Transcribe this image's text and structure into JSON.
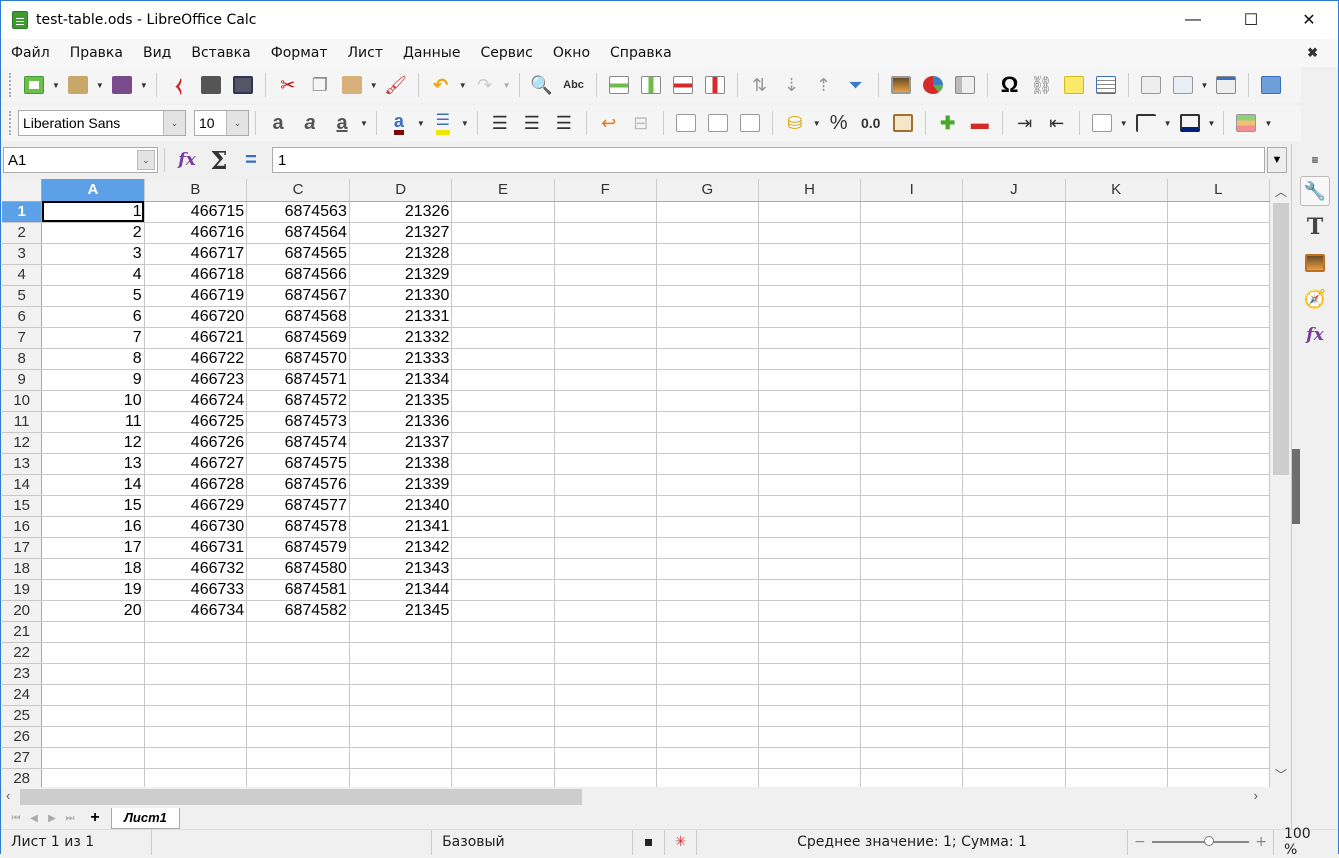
{
  "window": {
    "title": "test-table.ods - LibreOffice Calc",
    "minimize": "—",
    "maximize": "☐",
    "close": "✕"
  },
  "menu": [
    "Файл",
    "Правка",
    "Вид",
    "Вставка",
    "Формат",
    "Лист",
    "Данные",
    "Сервис",
    "Окно",
    "Справка"
  ],
  "menu_close": "✖",
  "toolbar_standard": [
    "new",
    "open",
    "save",
    "export-pdf",
    "print",
    "print-preview",
    "cut",
    "copy",
    "paste",
    "clone-formatting",
    "undo",
    "redo",
    "find-replace",
    "spelling",
    "insert-row",
    "insert-column",
    "delete-row",
    "delete-column",
    "sort",
    "sort-ascending",
    "sort-descending",
    "autofilter",
    "image",
    "chart",
    "pivot-table",
    "special-character",
    "hyperlink",
    "comment",
    "header-footer",
    "define-print-area",
    "freeze-rows-columns",
    "split-window",
    "show-draw-functions"
  ],
  "formatting": {
    "font_name": "Liberation Sans",
    "font_size": "10",
    "percent": "%",
    "number": "0.0",
    "add_decimal": ".0\n.00",
    "del_decimal": ".00"
  },
  "formula_bar": {
    "name_box": "A1",
    "content": "1",
    "fx": "fx",
    "sigma": "Σ",
    "equals": "="
  },
  "columns": [
    "A",
    "B",
    "C",
    "D",
    "E",
    "F",
    "G",
    "H",
    "I",
    "J",
    "K",
    "L"
  ],
  "rows": [
    [
      "1",
      "466715",
      "6874563",
      "21326"
    ],
    [
      "2",
      "466716",
      "6874564",
      "21327"
    ],
    [
      "3",
      "466717",
      "6874565",
      "21328"
    ],
    [
      "4",
      "466718",
      "6874566",
      "21329"
    ],
    [
      "5",
      "466719",
      "6874567",
      "21330"
    ],
    [
      "6",
      "466720",
      "6874568",
      "21331"
    ],
    [
      "7",
      "466721",
      "6874569",
      "21332"
    ],
    [
      "8",
      "466722",
      "6874570",
      "21333"
    ],
    [
      "9",
      "466723",
      "6874571",
      "21334"
    ],
    [
      "10",
      "466724",
      "6874572",
      "21335"
    ],
    [
      "11",
      "466725",
      "6874573",
      "21336"
    ],
    [
      "12",
      "466726",
      "6874574",
      "21337"
    ],
    [
      "13",
      "466727",
      "6874575",
      "21338"
    ],
    [
      "14",
      "466728",
      "6874576",
      "21339"
    ],
    [
      "15",
      "466729",
      "6874577",
      "21340"
    ],
    [
      "16",
      "466730",
      "6874578",
      "21341"
    ],
    [
      "17",
      "466731",
      "6874579",
      "21342"
    ],
    [
      "18",
      "466732",
      "6874580",
      "21343"
    ],
    [
      "19",
      "466733",
      "6874581",
      "21344"
    ],
    [
      "20",
      "466734",
      "6874582",
      "21345"
    ],
    [],
    [],
    [],
    [],
    [],
    [],
    [],
    []
  ],
  "active_cell": "A1",
  "sheet_tabs": {
    "add": "+",
    "tabs": [
      "Лист1"
    ]
  },
  "status": {
    "sheet": "Лист 1 из 1",
    "style": "Базовый",
    "summary": "Среднее значение: 1; Сумма: 1",
    "zoom": "100 %",
    "zoom_minus": "−",
    "zoom_plus": "+",
    "zoom_level_percent": 100
  },
  "sidebar": [
    "properties",
    "styles",
    "gallery",
    "navigator",
    "functions"
  ]
}
